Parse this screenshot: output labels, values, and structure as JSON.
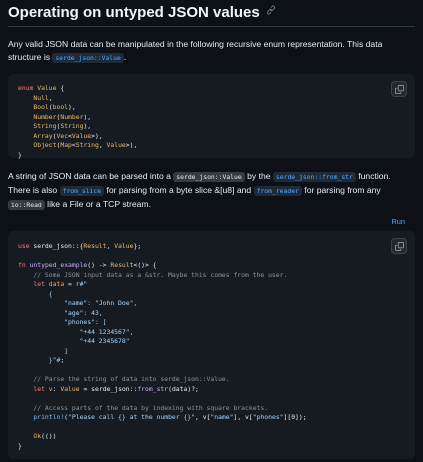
{
  "title": "Operating on untyped JSON values",
  "anchor_icon": "link-icon",
  "intro": {
    "text1": "Any valid JSON data can be manipulated in the following recursive enum representation. This data structure is ",
    "code1": "serde_json::Value",
    "text2": "."
  },
  "block1_lines": [
    "enum Value {",
    "    Null,",
    "    Bool(bool),",
    "    Number(Number),",
    "    String(String),",
    "    Array(Vec<Value>),",
    "    Object(Map<String, Value>),",
    "}"
  ],
  "para2": {
    "t1": "A string of JSON data can be parsed into a ",
    "c1": "serde_json::Value",
    "t2": " by the ",
    "c2": "serde_json::from_str",
    "t3": " function. There is also ",
    "c3": "from_slice",
    "t4": " for parsing from a byte slice &[u8] and ",
    "c4": "from_reader",
    "t5": " for parsing from any ",
    "c5": "io::Read",
    "t6": " like a File or a TCP stream."
  },
  "run_label": "Run",
  "block2_lines": [
    "use serde_json::{Result, Value};",
    "",
    "fn untyped_example() -> Result<()> {",
    "    // Some JSON input data as a &str. Maybe this comes from the user.",
    "    let data = r#\"",
    "        {",
    "            \"name\": \"John Doe\",",
    "            \"age\": 43,",
    "            \"phones\": [",
    "                \"+44 1234567\",",
    "                \"+44 2345678\"",
    "            ]",
    "        }\"#;",
    "",
    "    // Parse the string of data into serde_json::Value.",
    "    let v: Value = serde_json::from_str(data)?;",
    "",
    "    // Access parts of the data by indexing with square brackets.",
    "    println!(\"Please call {} at the number {}\", v[\"name\"], v[\"phones\"][0]);",
    "",
    "    Ok(())",
    "}"
  ],
  "colors": {
    "background": "#0d1117",
    "code_background": "#161b22",
    "keyword": "#ff7b72",
    "type": "#f0b86a",
    "function": "#d2a8ff",
    "string": "#a5d6ff",
    "comment": "#8b949e",
    "link": "#58a6ff"
  }
}
